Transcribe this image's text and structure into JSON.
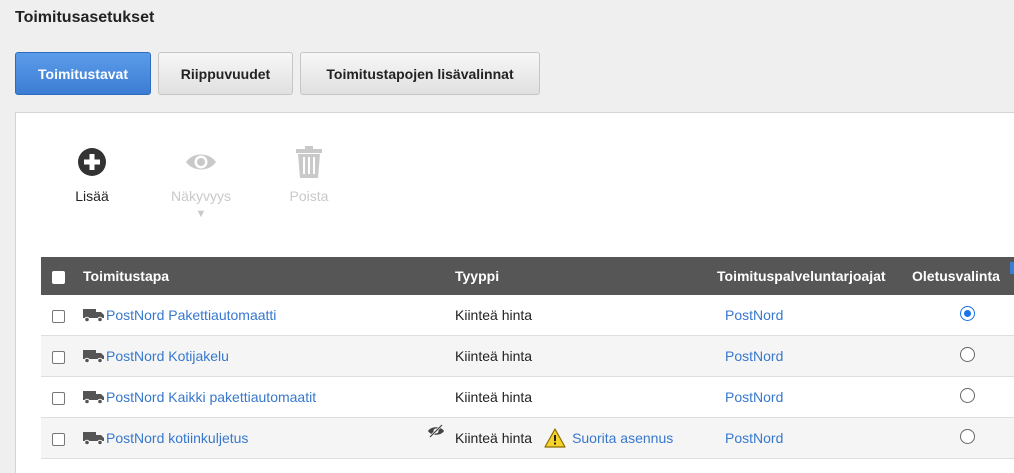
{
  "page": {
    "title": "Toimitusasetukset"
  },
  "tabs": [
    {
      "label": "Toimitustavat",
      "active": true
    },
    {
      "label": "Riippuvuudet",
      "active": false
    },
    {
      "label": "Toimitustapojen lisävalinnat",
      "active": false
    }
  ],
  "toolbar": {
    "add": {
      "label": "Lisää",
      "icon": "plus-circle-icon"
    },
    "visibility": {
      "label": "Näkyvyys",
      "arrow": "▼",
      "icon": "eye-icon",
      "disabled": true
    },
    "delete": {
      "label": "Poista",
      "icon": "trash-icon",
      "disabled": true
    }
  },
  "table": {
    "headers": {
      "name": "Toimitustapa",
      "type": "Tyyppi",
      "providers": "Toimituspalveluntarjoajat",
      "default": "Oletusvalinta"
    },
    "rows": [
      {
        "name": "PostNord Pakettiautomaatti",
        "type": "Kiinteä hinta",
        "provider": "PostNord",
        "default": true
      },
      {
        "name": "PostNord Kotijakelu",
        "type": "Kiinteä hinta",
        "provider": "PostNord",
        "default": false
      },
      {
        "name": "PostNord Kaikki pakettiautomaatit",
        "type": "Kiinteä hinta",
        "provider": "PostNord",
        "default": false
      },
      {
        "name": "PostNord kotiinkuljetus",
        "type": "Kiinteä hinta",
        "provider": "PostNord",
        "default": false,
        "hidden": true,
        "warning": "Suorita asennus"
      }
    ]
  },
  "colors": {
    "accent": "#3c7dd4",
    "link": "#3778cd",
    "header_bg": "#565656"
  }
}
